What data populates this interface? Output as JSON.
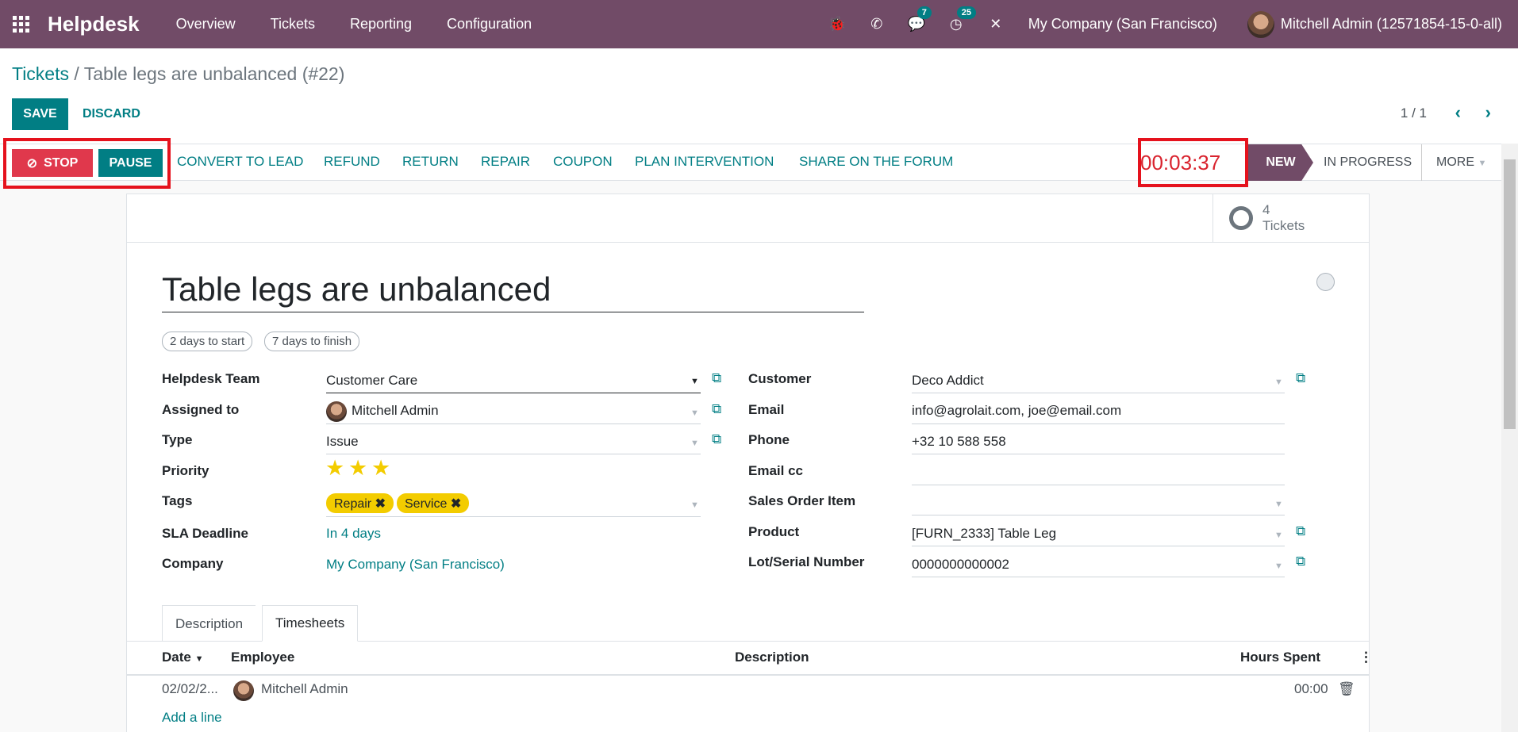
{
  "navbar": {
    "brand": "Helpdesk",
    "menu": [
      "Overview",
      "Tickets",
      "Reporting",
      "Configuration"
    ],
    "messages_count": "7",
    "activities_count": "25",
    "company": "My Company (San Francisco)",
    "user": "Mitchell Admin (12571854-15-0-all)"
  },
  "breadcrumb": {
    "parent": "Tickets",
    "separator": " / ",
    "current": "Table legs are unbalanced (#22)"
  },
  "form_buttons": {
    "save": "SAVE",
    "discard": "DISCARD"
  },
  "pager": "1 / 1",
  "header_buttons": {
    "stop": "STOP",
    "pause": "PAUSE",
    "actions": [
      "CONVERT TO LEAD",
      "REFUND",
      "RETURN",
      "REPAIR",
      "COUPON",
      "PLAN INTERVENTION",
      "SHARE ON THE FORUM"
    ]
  },
  "timer": "00:03:37",
  "stages": {
    "current": "NEW",
    "next": "IN PROGRESS",
    "more": "MORE"
  },
  "smart_button": {
    "count": "4",
    "label": "Tickets"
  },
  "ticket": {
    "title": "Table legs are unbalanced",
    "start_badge": "2 days to start",
    "finish_badge": "7 days to finish",
    "priority_value": 3,
    "left_labels": {
      "team": "Helpdesk Team",
      "assigned": "Assigned to",
      "type": "Type",
      "priority": "Priority",
      "tags": "Tags",
      "sla": "SLA Deadline",
      "company": "Company"
    },
    "left_values": {
      "team": "Customer Care",
      "assigned": "Mitchell Admin",
      "type": "Issue",
      "tags": [
        "Repair",
        "Service"
      ],
      "sla": "In 4 days",
      "company": "My Company (San Francisco)"
    },
    "right_labels": {
      "customer": "Customer",
      "email": "Email",
      "phone": "Phone",
      "email_cc": "Email cc",
      "sales_order_item": "Sales Order Item",
      "product": "Product",
      "lot": "Lot/Serial Number"
    },
    "right_values": {
      "customer": "Deco Addict",
      "email": "info@agrolait.com, joe@email.com",
      "phone": "+32 10 588 558",
      "email_cc": "",
      "sales_order_item": "",
      "product": "[FURN_2333] Table Leg",
      "lot": "0000000000002"
    }
  },
  "tabs": [
    "Description",
    "Timesheets"
  ],
  "timesheet": {
    "columns": {
      "date": "Date",
      "employee": "Employee",
      "description": "Description",
      "hours": "Hours Spent"
    },
    "rows": [
      {
        "date": "02/02/2...",
        "employee": "Mitchell Admin",
        "description": "",
        "hours": "00:00"
      }
    ],
    "add_line": "Add a line"
  }
}
